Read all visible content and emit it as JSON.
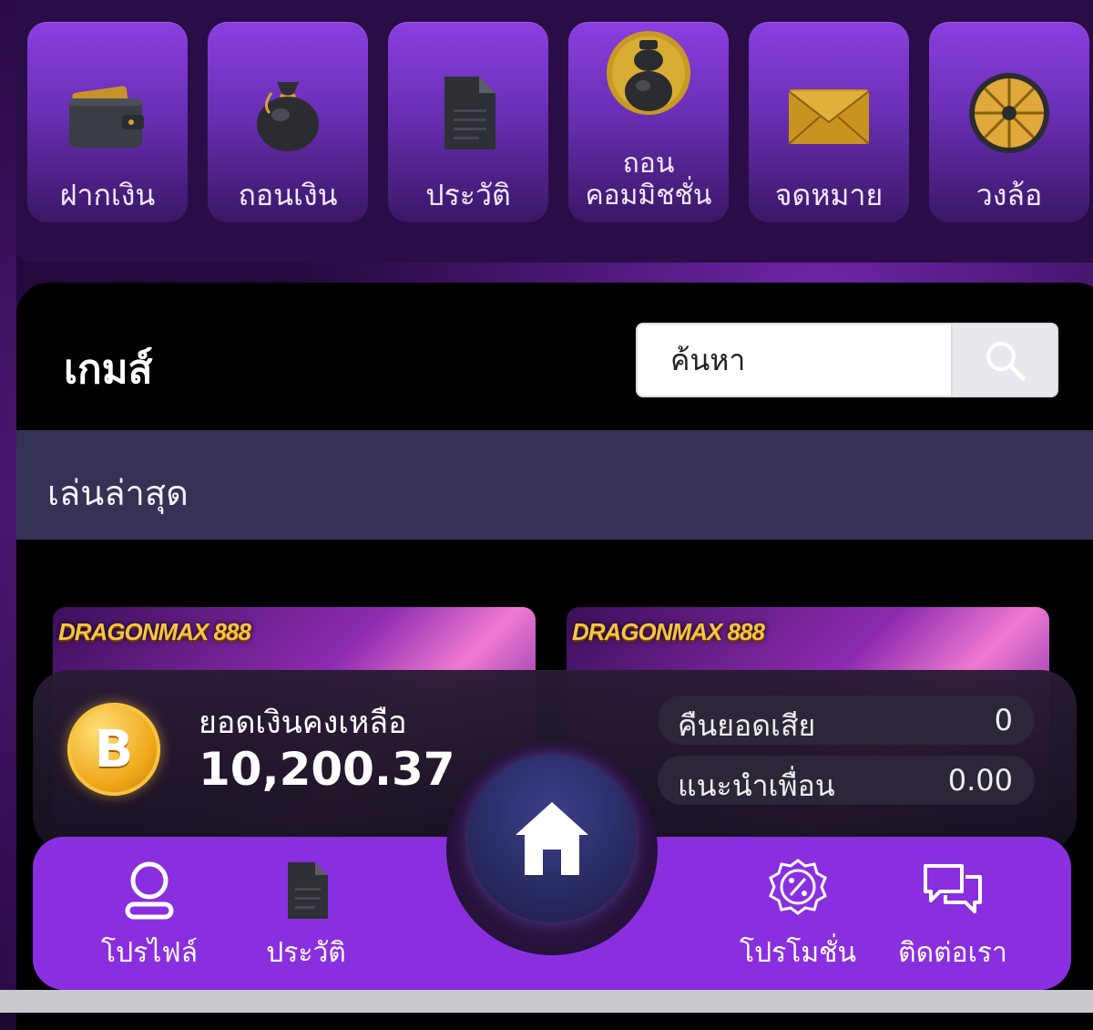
{
  "menu": {
    "items": [
      {
        "label": "ฝากเงิน",
        "icon": "wallet-icon"
      },
      {
        "label": "ถอนเงิน",
        "icon": "money-bag-icon"
      },
      {
        "label": "ประวัติ",
        "icon": "document-icon"
      },
      {
        "label": "ถอนคอมมิชชั่น",
        "icon": "pot-icon"
      },
      {
        "label": "จดหมาย",
        "icon": "envelope-icon"
      },
      {
        "label": "วงล้อ",
        "icon": "wheel-icon"
      }
    ]
  },
  "games": {
    "title": "เกมส์",
    "search_placeholder": "ค้นหา",
    "recent_label": "เล่นล่าสุด",
    "thumb_brand": "DRAGONMAX 888"
  },
  "balance": {
    "label": "ยอดเงินคงเหลือ",
    "value": "10,200.37",
    "coin_symbol": "B",
    "stats": [
      {
        "label": "คืนยอดเสีย",
        "value": "0"
      },
      {
        "label": "แนะนำเพื่อน",
        "value": "0.00"
      }
    ]
  },
  "nav": {
    "profile": "โปรไฟล์",
    "history": "ประวัติ",
    "promotion": "โปรโมชั่น",
    "contact": "ติดต่อเรา"
  },
  "colors": {
    "tile_top": "#8a3fe0",
    "nav_bg": "#8a2fe0",
    "recent_bar": "#363255"
  }
}
